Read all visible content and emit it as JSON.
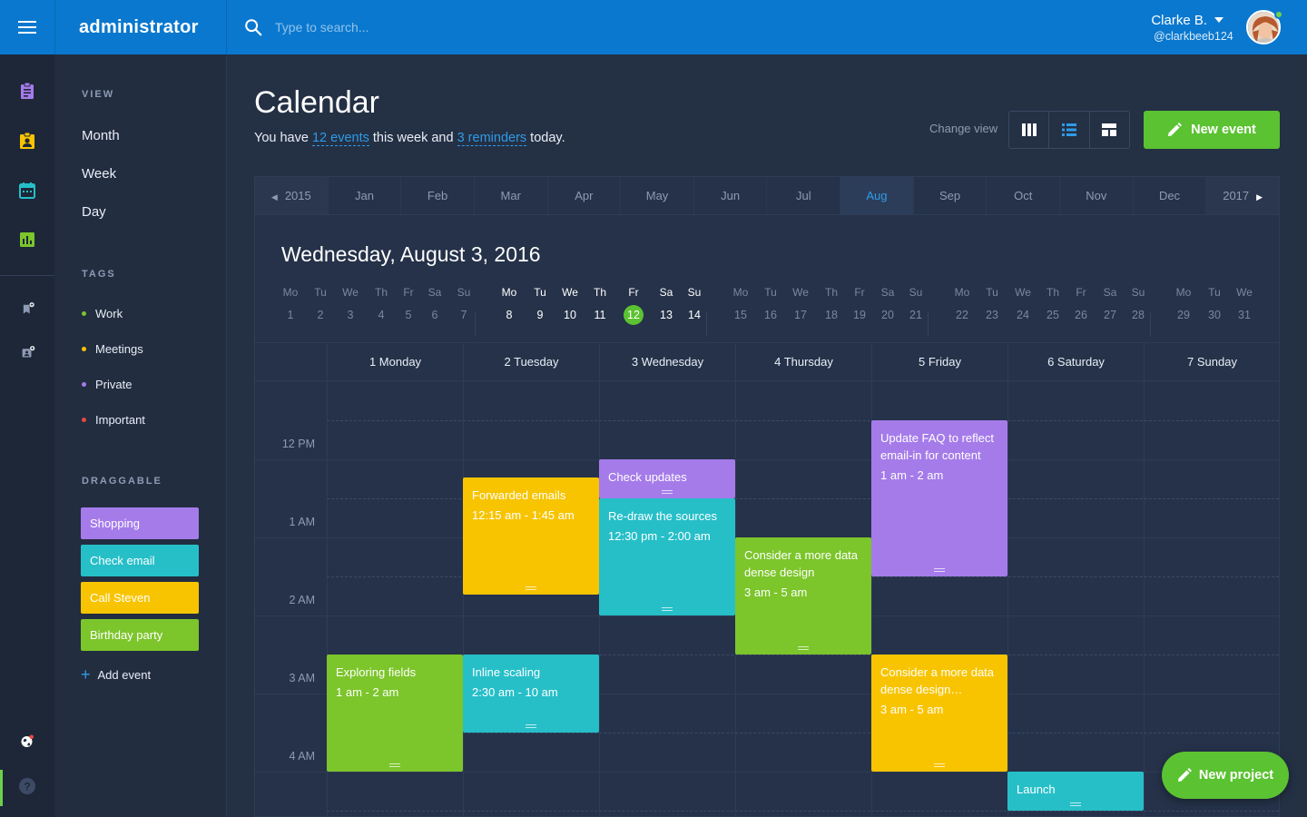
{
  "app": {
    "brand": "administrator"
  },
  "search": {
    "placeholder": "Type to search..."
  },
  "user": {
    "name": "Clarke B.",
    "handle": "@clarkbeeb124"
  },
  "colors": {
    "topbar": "#0a78cf",
    "accent_blue": "#2f9be8",
    "green": "#5bc232",
    "purple": "#a57bea",
    "teal": "#26bfc8",
    "yellow": "#f8c400",
    "lime": "#7cc52b",
    "red": "#e8483f"
  },
  "rail": {
    "icons": [
      "clipboard-icon",
      "contact-badge-icon",
      "calendar-icon",
      "bar-chart-icon",
      "bookmark-add-icon",
      "contact-add-icon",
      "globe-icon",
      "help-icon"
    ]
  },
  "sidebar": {
    "view_heading": "VIEW",
    "views": [
      "Month",
      "Week",
      "Day"
    ],
    "tags_heading": "TAGS",
    "tags": [
      {
        "label": "Work",
        "color": "#7cc52b"
      },
      {
        "label": "Meetings",
        "color": "#f8c400"
      },
      {
        "label": "Private",
        "color": "#a57bea"
      },
      {
        "label": "Important",
        "color": "#e8483f"
      }
    ],
    "draggable_heading": "DRAGGABLE",
    "draggable": [
      {
        "label": "Shopping",
        "color": "#a57bea"
      },
      {
        "label": "Check email",
        "color": "#26bfc8"
      },
      {
        "label": "Call Steven",
        "color": "#f8c400"
      },
      {
        "label": "Birthday party",
        "color": "#7cc52b"
      }
    ],
    "add_event": "Add event"
  },
  "page": {
    "title": "Calendar",
    "summary_prefix": "You have ",
    "events_link": "12 events",
    "summary_mid": " this week and ",
    "reminders_link": "3 reminders",
    "summary_suffix": " today.",
    "change_view": "Change view",
    "new_event": "New event"
  },
  "months_bar": {
    "prev_year": "2015",
    "next_year": "2017",
    "months": [
      "Jan",
      "Feb",
      "Mar",
      "Apr",
      "May",
      "Jun",
      "Jul",
      "Aug",
      "Sep",
      "Oct",
      "Nov",
      "Dec"
    ],
    "active": "Aug"
  },
  "date_title": "Wednesday, August 3,  2016",
  "mini_calendar": [
    {
      "wd": "Mo",
      "d": "1"
    },
    {
      "wd": "Tu",
      "d": "2"
    },
    {
      "wd": "We",
      "d": "3"
    },
    {
      "wd": "Th",
      "d": "4"
    },
    {
      "wd": "Fr",
      "d": "5"
    },
    {
      "wd": "Sa",
      "d": "6"
    },
    {
      "wd": "Su",
      "d": "7"
    },
    {
      "wd": "Mo",
      "d": "8",
      "current": true
    },
    {
      "wd": "Tu",
      "d": "9",
      "current": true
    },
    {
      "wd": "We",
      "d": "10",
      "current": true
    },
    {
      "wd": "Th",
      "d": "11",
      "current": true
    },
    {
      "wd": "Fr",
      "d": "12",
      "current": true,
      "today": true
    },
    {
      "wd": "Sa",
      "d": "13",
      "current": true
    },
    {
      "wd": "Su",
      "d": "14",
      "current": true
    },
    {
      "wd": "Mo",
      "d": "15"
    },
    {
      "wd": "Tu",
      "d": "16"
    },
    {
      "wd": "We",
      "d": "17"
    },
    {
      "wd": "Th",
      "d": "18"
    },
    {
      "wd": "Fr",
      "d": "19"
    },
    {
      "wd": "Sa",
      "d": "20"
    },
    {
      "wd": "Su",
      "d": "21"
    },
    {
      "wd": "Mo",
      "d": "22"
    },
    {
      "wd": "Tu",
      "d": "23"
    },
    {
      "wd": "We",
      "d": "24"
    },
    {
      "wd": "Th",
      "d": "25"
    },
    {
      "wd": "Fr",
      "d": "26"
    },
    {
      "wd": "Sa",
      "d": "27"
    },
    {
      "wd": "Su",
      "d": "28"
    },
    {
      "wd": "Mo",
      "d": "29"
    },
    {
      "wd": "Tu",
      "d": "30"
    },
    {
      "wd": "We",
      "d": "31"
    }
  ],
  "week_days": [
    "1 Monday",
    "2 Tuesday",
    "3 Wednesday",
    "4 Thursday",
    "5 Friday",
    "6 Saturday",
    "7 Sunday"
  ],
  "hours": [
    "12 PM",
    "1 AM",
    "2 AM",
    "3 AM",
    "4 AM"
  ],
  "events": [
    {
      "title": "Exploring fields",
      "time": "1 am - 2 am",
      "day": 0,
      "start": 3.5,
      "end": 5.0,
      "color": "#7cc52b"
    },
    {
      "title": "Forwarded emails",
      "time": "12:15 am - 1:45 am",
      "day": 1,
      "start": 1.23,
      "end": 2.73,
      "color": "#f8c400"
    },
    {
      "title": "Inline scaling",
      "time": "2:30 am - 10 am",
      "day": 1,
      "start": 3.5,
      "end": 4.5,
      "color": "#26bfc8"
    },
    {
      "title": "Check updates",
      "time": "",
      "day": 2,
      "start": 1.0,
      "end": 1.5,
      "color": "#a57bea"
    },
    {
      "title": "Re-draw the sources",
      "time": "12:30 pm - 2:00 am",
      "day": 2,
      "start": 1.5,
      "end": 3.0,
      "color": "#26bfc8"
    },
    {
      "title": "Consider a more data dense design",
      "time": "3 am - 5 am",
      "day": 3,
      "start": 2.0,
      "end": 3.5,
      "color": "#7cc52b"
    },
    {
      "title": "Update FAQ to reflect email-in for content",
      "time": "1 am - 2 am",
      "day": 4,
      "start": 0.5,
      "end": 2.5,
      "color": "#a57bea"
    },
    {
      "title": "Consider a more data dense design…",
      "time": "3 am - 5 am",
      "day": 4,
      "start": 3.5,
      "end": 5.0,
      "color": "#f8c400"
    },
    {
      "title": "Launch",
      "time": "",
      "day": 5,
      "start": 5.0,
      "end": 5.5,
      "color": "#26bfc8"
    }
  ],
  "fab": {
    "label": "New project"
  }
}
